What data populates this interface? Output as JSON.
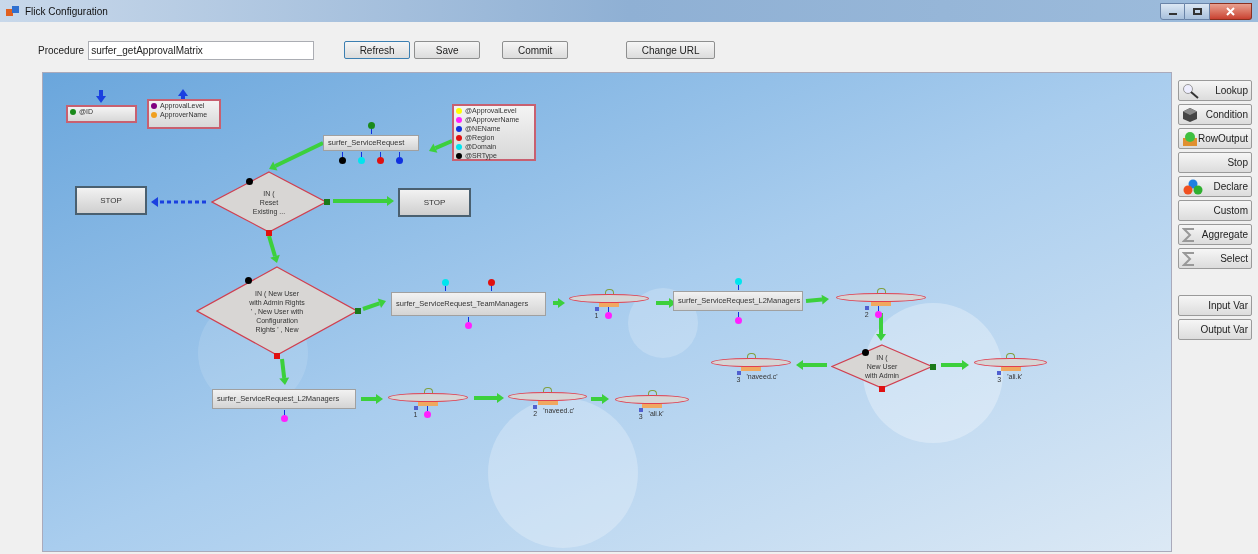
{
  "window": {
    "title": "Flick Configuration"
  },
  "toolbar": {
    "procedure_label": "Procedure",
    "procedure_value": "surfer_getApprovalMatrix",
    "buttons": [
      "Refresh",
      "Save",
      "Commit",
      "Change URL"
    ]
  },
  "canvas": {
    "nodes": [
      {
        "kind": "variables",
        "items": [
          {
            "name": "@ID",
            "color": "#1a8a1a"
          }
        ]
      },
      {
        "kind": "variables",
        "items": [
          {
            "name": "ApprovalLevel",
            "color": "#800080"
          },
          {
            "name": "ApproverName",
            "color": "#f0a020"
          }
        ]
      },
      {
        "kind": "procedure",
        "label": "surfer_ServiceRequest",
        "pins_top": [
          {
            "color": "#1a8a1a"
          }
        ],
        "pins_bottom": [
          {
            "color": "#000000"
          },
          {
            "color": "#00e5ee"
          },
          {
            "color": "#e01010"
          },
          {
            "color": "#1030e0"
          }
        ]
      },
      {
        "kind": "variables",
        "items": [
          {
            "name": "@ApprovalLevel",
            "color": "#ffff00"
          },
          {
            "name": "@ApproverName",
            "color": "#ff20ff"
          },
          {
            "name": "@NEName",
            "color": "#1030e0"
          },
          {
            "name": "@Region",
            "color": "#e01010"
          },
          {
            "name": "@Domain",
            "color": "#00e5ee"
          },
          {
            "name": "@SRType",
            "color": "#000000"
          }
        ]
      },
      {
        "kind": "stop",
        "label": "STOP"
      },
      {
        "kind": "condition",
        "lines": [
          "IN (",
          "Reset",
          "Existing ..."
        ]
      },
      {
        "kind": "stop",
        "label": "STOP"
      },
      {
        "kind": "condition",
        "lines": [
          "IN ( New User",
          "with Admin Rights",
          "' , New User with",
          "Configuration",
          "Rights ' , New"
        ]
      },
      {
        "kind": "procedure",
        "label": "surfer_ServiceRequest_TeamManagers",
        "pins_top": [
          {
            "color": "#00e5ee"
          },
          {
            "color": "#e01010"
          }
        ],
        "pins_bottom": [
          {
            "color": "#ff20ff"
          }
        ]
      },
      {
        "kind": "output_row",
        "index": "1",
        "pins": [
          {
            "color": "#ff20ff"
          }
        ]
      },
      {
        "kind": "procedure",
        "label": "surfer_ServiceRequest_L2Managers",
        "pins_top": [
          {
            "color": "#00e5ee"
          }
        ],
        "pins_bottom": [
          {
            "color": "#ff20ff"
          }
        ]
      },
      {
        "kind": "output_row",
        "index": "2",
        "pins": [
          {
            "color": "#ff20ff"
          }
        ]
      },
      {
        "kind": "output_row",
        "index": "3",
        "value": "'naveed.c'"
      },
      {
        "kind": "condition",
        "lines": [
          "IN (",
          "New User",
          "with Admin"
        ]
      },
      {
        "kind": "output_row",
        "index": "3",
        "value": "'ali.k'"
      },
      {
        "kind": "procedure",
        "label": "surfer_ServiceRequest_L2Managers",
        "pins_bottom": [
          {
            "color": "#ff20ff"
          }
        ]
      },
      {
        "kind": "output_row",
        "index": "1",
        "pins": [
          {
            "color": "#ff20ff"
          }
        ]
      },
      {
        "kind": "output_row",
        "index": "2",
        "value": "'naveed.c'"
      },
      {
        "kind": "output_row",
        "index": "3",
        "value": "'ali.k'"
      }
    ]
  },
  "palette": {
    "tools": [
      {
        "label": "Lookup"
      },
      {
        "label": "Condition"
      },
      {
        "label": "RowOutput"
      },
      {
        "label": "Stop"
      },
      {
        "label": "Declare"
      },
      {
        "label": "Custom"
      },
      {
        "label": "Aggregate"
      },
      {
        "label": "Select"
      }
    ],
    "variables": [
      {
        "label": "Input Var"
      },
      {
        "label": "Output Var"
      }
    ]
  }
}
